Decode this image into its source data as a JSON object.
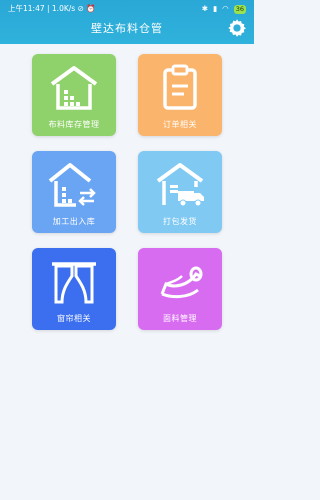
{
  "status_bar": {
    "left": "上午11:47 | 1.0K/s ⊘ ⏰",
    "battery": "36"
  },
  "header": {
    "title": "壁达布料仓管"
  },
  "tiles": [
    {
      "label": "布料库存管理",
      "color": "#8fd16a"
    },
    {
      "label": "订单相关",
      "color": "#fbb46b"
    },
    {
      "label": "加工出入库",
      "color": "#6aa5f3"
    },
    {
      "label": "打包发货",
      "color": "#7fc9f3"
    },
    {
      "label": "窗帘相关",
      "color": "#3b6ff0"
    },
    {
      "label": "面料管理",
      "color": "#d86cf1"
    }
  ]
}
